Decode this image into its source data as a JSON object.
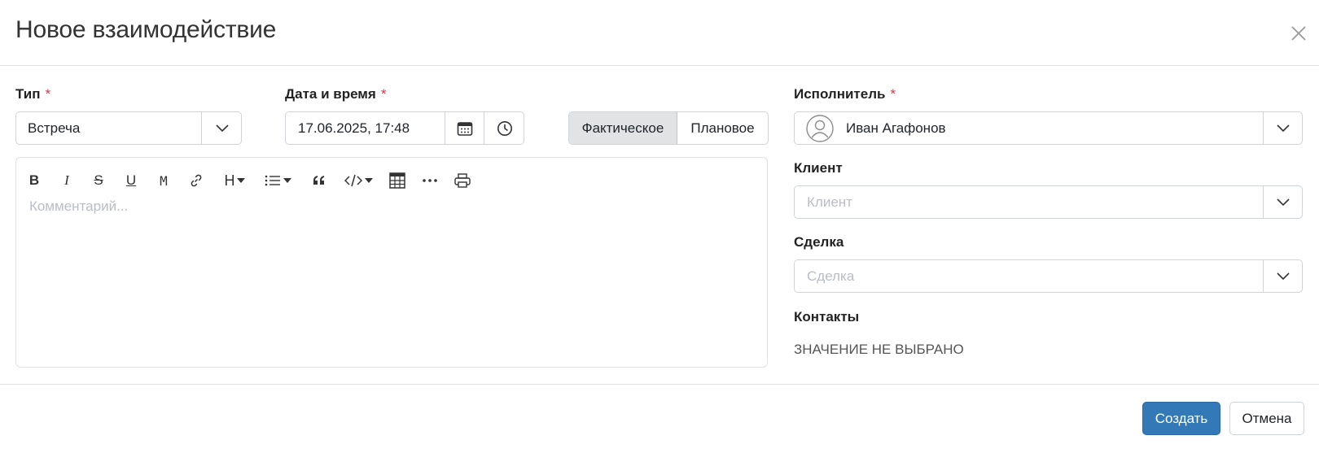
{
  "modal": {
    "title": "Новое взаимодействие"
  },
  "fields": {
    "type": {
      "label": "Тип",
      "required_mark": "*",
      "value": "Встреча"
    },
    "datetime": {
      "label": "Дата и время",
      "required_mark": "*",
      "value": "17.06.2025, 17:48"
    },
    "mode_toggle": {
      "options": [
        "Фактическое",
        "Плановое"
      ],
      "selected": "Фактическое"
    },
    "assignee": {
      "label": "Исполнитель",
      "required_mark": "*",
      "value": "Иван Агафонов"
    },
    "client": {
      "label": "Клиент",
      "placeholder": "Клиент"
    },
    "deal": {
      "label": "Сделка",
      "placeholder": "Сделка"
    },
    "contacts": {
      "label": "Контакты",
      "value": "ЗНАЧЕНИЕ НЕ ВЫБРАНО"
    }
  },
  "editor": {
    "placeholder": "Комментарий...",
    "toolbar": {
      "bold": "B",
      "italic": "I",
      "strike": "S",
      "underline": "U",
      "mono": "M",
      "heading": "H"
    }
  },
  "footer": {
    "create_label": "Создать",
    "cancel_label": "Отмена"
  },
  "colors": {
    "primary": "#3479b7",
    "required": "#dc3545",
    "border": "#ced4da",
    "active_toggle_bg": "#e2e3e5"
  }
}
